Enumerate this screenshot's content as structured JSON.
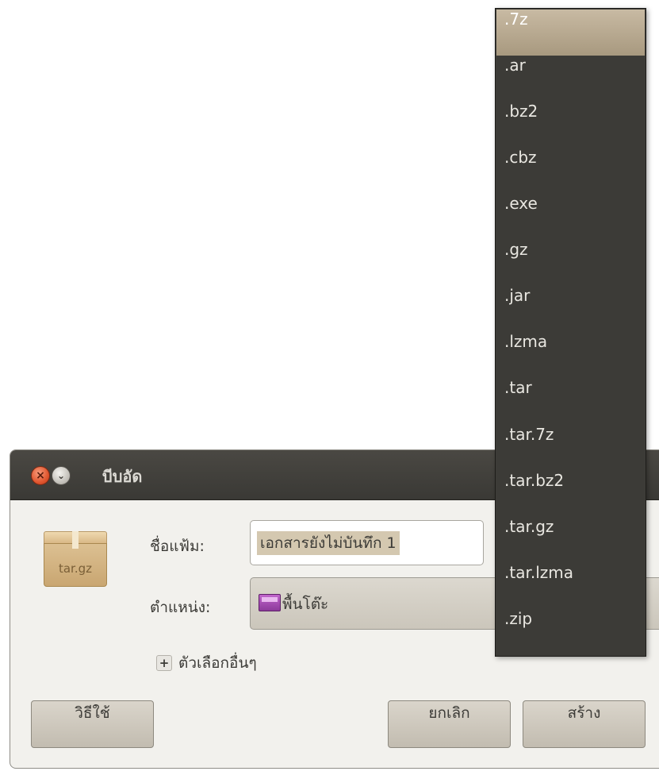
{
  "window": {
    "title": "บีบอัด",
    "close_glyph": "×",
    "menu_glyph": "⌄"
  },
  "icon": {
    "name": "archive-box-icon",
    "label": "tar.gz"
  },
  "form": {
    "filename_label": "ชื่อแฟ้ม:",
    "filename_value": "เอกสารยังไม่บันทึก 1",
    "location_label": "ตำแหน่ง:",
    "location_value": "พื้นโต๊ะ",
    "more_options_label": "ตัวเลือกอื่นๆ",
    "more_options_glyph": "+"
  },
  "buttons": {
    "help": "วิธีใช้",
    "cancel": "ยกเลิก",
    "create": "สร้าง"
  },
  "extension_menu": {
    "selected": ".7z",
    "items": [
      ".7z",
      ".ar",
      ".bz2",
      ".cbz",
      ".exe",
      ".gz",
      ".jar",
      ".lzma",
      ".tar",
      ".tar.7z",
      ".tar.bz2",
      ".tar.gz",
      ".tar.lzma",
      ".zip"
    ]
  },
  "colors": {
    "titlebar": "#3c3b37",
    "menu_background": "#3c3b37",
    "menu_highlight": "#b8aa91",
    "dialog_background": "#f2f1ed"
  }
}
